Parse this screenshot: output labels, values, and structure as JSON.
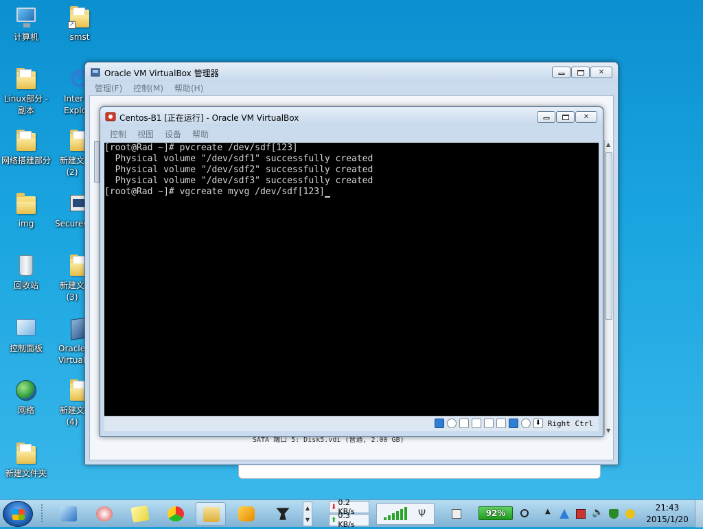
{
  "desktop": {
    "icons": [
      {
        "label": "计算机"
      },
      {
        "label": "smst"
      },
      {
        "label": "Linux部分 -\n副本"
      },
      {
        "label": "Inter\nExplo"
      },
      {
        "label": "网络搭建部分"
      },
      {
        "label": "新建文\n(2)"
      },
      {
        "label": "img"
      },
      {
        "label": "SecureC"
      },
      {
        "label": "回收站"
      },
      {
        "label": "新建文\n(3)"
      },
      {
        "label": "控制面板"
      },
      {
        "label": "Oracle\nVirtual"
      },
      {
        "label": "网络"
      },
      {
        "label": "新建文\n(4)"
      },
      {
        "label": "新建文件夹"
      }
    ]
  },
  "manager_window": {
    "title": "Oracle VM VirtualBox 管理器",
    "menu": [
      "管理(F)",
      "控制(M)",
      "帮助(H)"
    ],
    "behind_text": "SATA 端口 5:        Disk5.vdi (普通, 2.00 GB)"
  },
  "vm_window": {
    "title": "Centos-B1 [正在运行] - Oracle VM VirtualBox",
    "menu": [
      "控制",
      "视图",
      "设备",
      "帮助"
    ],
    "terminal_lines": [
      "[root@Rad ~]# pvcreate /dev/sdf[123]",
      "  Physical volume \"/dev/sdf1\" successfully created",
      "  Physical volume \"/dev/sdf2\" successfully created",
      "  Physical volume \"/dev/sdf3\" successfully created",
      "[root@Rad ~]# vgcreate myvg /dev/sdf[123]"
    ],
    "host_key": "Right Ctrl"
  },
  "taskbar": {
    "net_down": "0.2 KB/s",
    "net_up": "0.3 KB/s",
    "battery": "92%",
    "time": "21:43",
    "date": "2015/1/20"
  }
}
